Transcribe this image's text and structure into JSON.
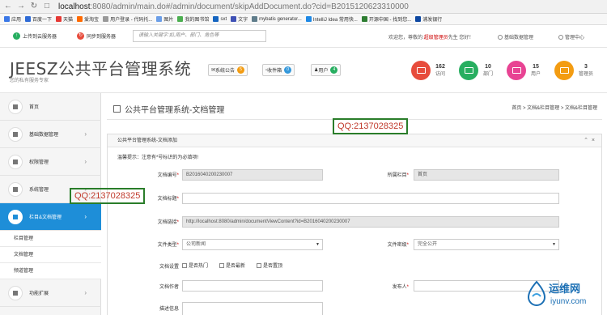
{
  "browser": {
    "url_host": "localhost",
    "url_rest": ":8080/admin/main.do#/admin/document/skipAddDocument.do?cid=B2015120623310000",
    "bookmarks": [
      "应用",
      "百度一下",
      "天猫",
      "爱淘宝",
      "用户登录 - 代码托...",
      "图片",
      "我的图书馆",
      "sxt",
      "文字",
      "mybatis generator...",
      "IntelliJ Idea 常用快...",
      "开源中国 - 找到您...",
      "浦发银行"
    ],
    "bookmark_colors": [
      "#3b78e7",
      "#2f6bd6",
      "#e53935",
      "#ff6a00",
      "#999999",
      "#6b9ee8",
      "#4caf50",
      "#1565c0",
      "#3f51b5",
      "#607d8b",
      "#1e88e5",
      "#2e7d32",
      "#0d47a1"
    ]
  },
  "topbar": {
    "upload_label": "上传到云服务器",
    "sync_label": "同步到服务器",
    "search_placeholder": "请输入关键字:如,用户、部门、角色等",
    "welcome_prefix": "欢迎您，尊敬的:",
    "welcome_role": "超级管理员",
    "welcome_suffix": "先生 您好！",
    "base_info_label": "基础数据管理",
    "admin_center_label": "管理中心"
  },
  "header": {
    "logo": "JEESZ公共平台管理系统",
    "slogan": "您的私有服务专家",
    "notice_label": "系统公告",
    "notice_count": "5",
    "inbox_label": "收件箱",
    "inbox_count": "0",
    "user_label": "用户",
    "user_count": "4",
    "stats": [
      {
        "num": "162",
        "label": "访问",
        "color": "#e74c3c"
      },
      {
        "num": "10",
        "label": "部门",
        "color": "#27ae60"
      },
      {
        "num": "15",
        "label": "用户",
        "color": "#e84393"
      },
      {
        "num": "3",
        "label": "管理员",
        "color": "#f39c12"
      }
    ]
  },
  "sidebar": {
    "items": [
      {
        "label": "首页"
      },
      {
        "label": "基础数据管理"
      },
      {
        "label": "权限管理"
      },
      {
        "label": "系统管理"
      },
      {
        "label": "栏目&文档管理"
      }
    ],
    "subitems": [
      "栏目管理",
      "文档管理",
      "频道管理"
    ],
    "extra": "功能扩展"
  },
  "content": {
    "page_title": "公共平台管理系统-文档管理",
    "breadcrumb": "首页 > 文档&栏目管理 > 文档&栏目管理",
    "panel_title": "公共平台管理系统-文档添加",
    "warn_prefix": "温馨提示：",
    "warn_text": "注意有*号标识的为必填项!",
    "fields": {
      "doc_no_label": "文档编号",
      "doc_no_value": "B2016040200230007",
      "column_label": "所属栏目",
      "column_value": "首页",
      "title_label": "文档标题",
      "link_label": "文档链接",
      "link_value": "http://localhost:8080/admin/documentViewContent?id=B2016040200230007",
      "type_label": "文件类型",
      "type_value": "公司新闻",
      "secret_label": "文件密级",
      "secret_value": "完全公开",
      "settings_label": "文档设置",
      "cb1": "是否热门",
      "cb2": "是否最新",
      "cb3": "是否置顶",
      "author_label": "文档作者",
      "publisher_label": "发布人",
      "desc_label": "描述信息"
    }
  },
  "overlay": {
    "qq_top": "QQ:2137028325",
    "qq_left": "QQ:2137028325"
  },
  "watermark": {
    "cn": "运维网",
    "en": "iyunv.com"
  }
}
